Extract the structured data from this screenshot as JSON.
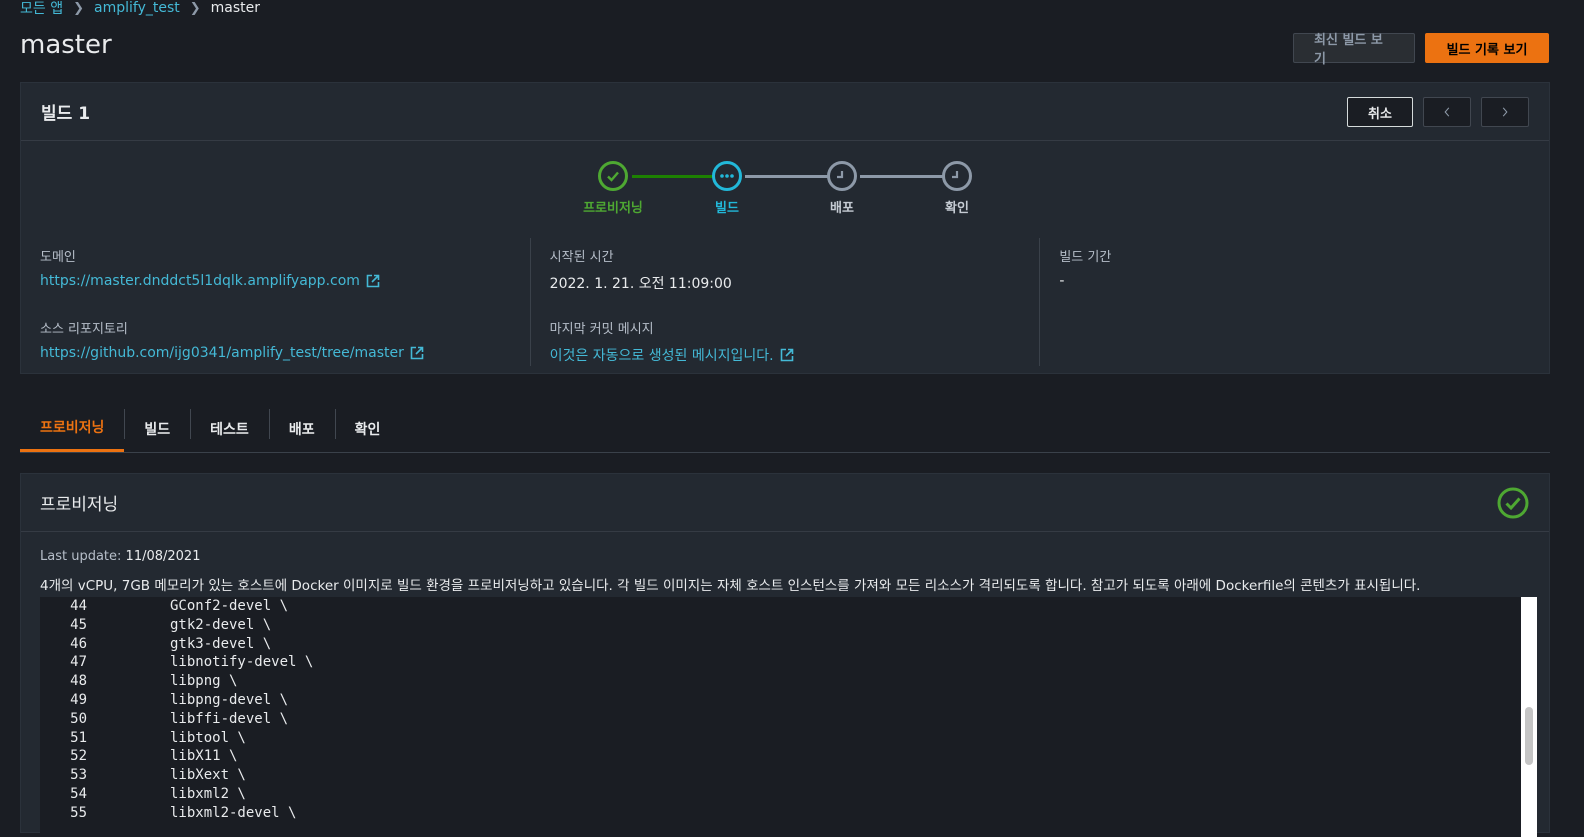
{
  "breadcrumb": {
    "items": [
      "모든 앱",
      "amplify_test"
    ],
    "current": "master"
  },
  "page": {
    "title": "master",
    "latest_build_label": "최신 빌드 보기",
    "build_history_label": "빌드 기록 보기"
  },
  "build": {
    "title": "빌드 1",
    "cancel_label": "취소",
    "steps": [
      {
        "label": "프로비저닝",
        "status": "complete"
      },
      {
        "label": "빌드",
        "status": "in-progress"
      },
      {
        "label": "배포",
        "status": "pending"
      },
      {
        "label": "확인",
        "status": "pending"
      }
    ],
    "info": {
      "domain_label": "도메인",
      "domain_value": "https://master.dnddct5l1dqlk.amplifyapp.com",
      "source_repo_label": "소스 리포지토리",
      "source_repo_value": "https://github.com/ijg0341/amplify_test/tree/master",
      "started_label": "시작된 시간",
      "started_value": "2022. 1. 21. 오전 11:09:00",
      "last_commit_label": "마지막 커밋 메시지",
      "last_commit_value": "이것은 자동으로 생성된 메시지입니다.",
      "duration_label": "빌드 기간",
      "duration_value": "-"
    }
  },
  "tabs": [
    {
      "label": "프로비저닝",
      "active": true
    },
    {
      "label": "빌드",
      "active": false
    },
    {
      "label": "테스트",
      "active": false
    },
    {
      "label": "배포",
      "active": false
    },
    {
      "label": "확인",
      "active": false
    }
  ],
  "provisioning": {
    "title": "프로비저닝",
    "last_update_label": "Last update:",
    "last_update_value": "11/08/2021",
    "description": "4개의 vCPU, 7GB 메모리가 있는 호스트에 Docker 이미지로 빌드 환경을 프로비저닝하고 있습니다. 각 빌드 이미지는 자체 호스트 인스턴스를 가져와 모든 리소스가 격리되도록 합니다. 참고가 되도록 아래에 Dockerfile의 콘텐츠가 표시됩니다.",
    "code_lines": [
      {
        "ln": "44",
        "code": "GConf2-devel \\"
      },
      {
        "ln": "45",
        "code": "gtk2-devel \\"
      },
      {
        "ln": "46",
        "code": "gtk3-devel \\"
      },
      {
        "ln": "47",
        "code": "libnotify-devel \\"
      },
      {
        "ln": "48",
        "code": "libpng \\"
      },
      {
        "ln": "49",
        "code": "libpng-devel \\"
      },
      {
        "ln": "50",
        "code": "libffi-devel \\"
      },
      {
        "ln": "51",
        "code": "libtool \\"
      },
      {
        "ln": "52",
        "code": "libX11 \\"
      },
      {
        "ln": "53",
        "code": "libXext \\"
      },
      {
        "ln": "54",
        "code": "libxml2 \\"
      },
      {
        "ln": "55",
        "code": "libxml2-devel \\"
      }
    ]
  },
  "colors": {
    "accent": "#ec7211",
    "link": "#44b9d6",
    "success": "#4ea832",
    "in_progress": "#22b8d9",
    "pending": "#8d99a8"
  }
}
